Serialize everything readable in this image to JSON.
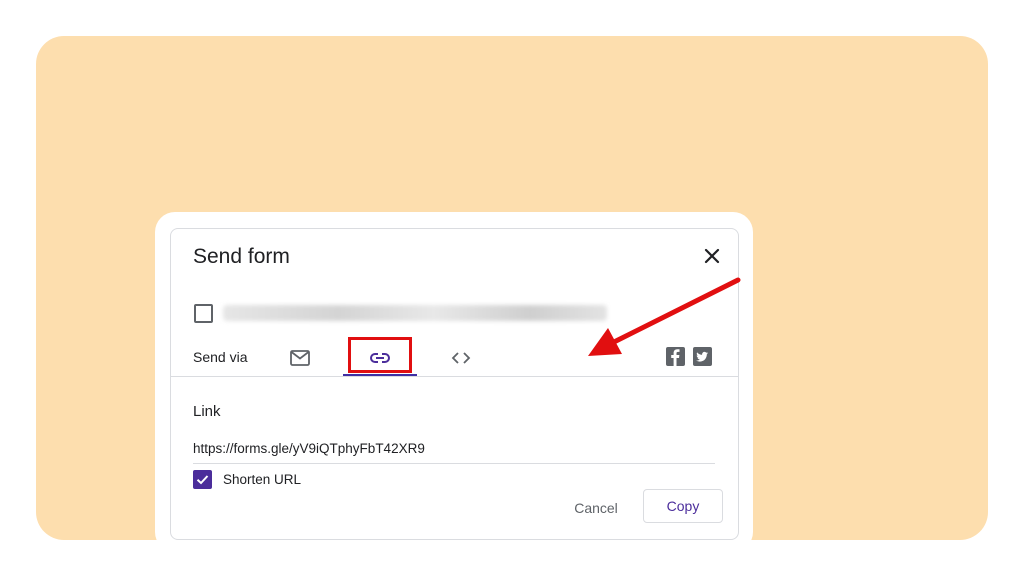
{
  "dialog": {
    "title": "Send form",
    "close_icon": "close-icon",
    "collect_emails_checked": false,
    "send_via_label": "Send via",
    "tabs": [
      {
        "icon": "email-icon",
        "selected": false
      },
      {
        "icon": "link-icon",
        "selected": true
      },
      {
        "icon": "embed-icon",
        "selected": false
      }
    ],
    "social": [
      "facebook-icon",
      "twitter-icon"
    ],
    "link_section": {
      "label": "Link",
      "url": "https://forms.gle/yV9iQTphyFbT42XR9",
      "shorten_label": "Shorten URL",
      "shorten_checked": true
    },
    "actions": {
      "cancel": "Cancel",
      "copy": "Copy"
    }
  },
  "colors": {
    "background_panel": "#fddeae",
    "accent": "#4b2d9b",
    "annotation": "#e10f10"
  }
}
